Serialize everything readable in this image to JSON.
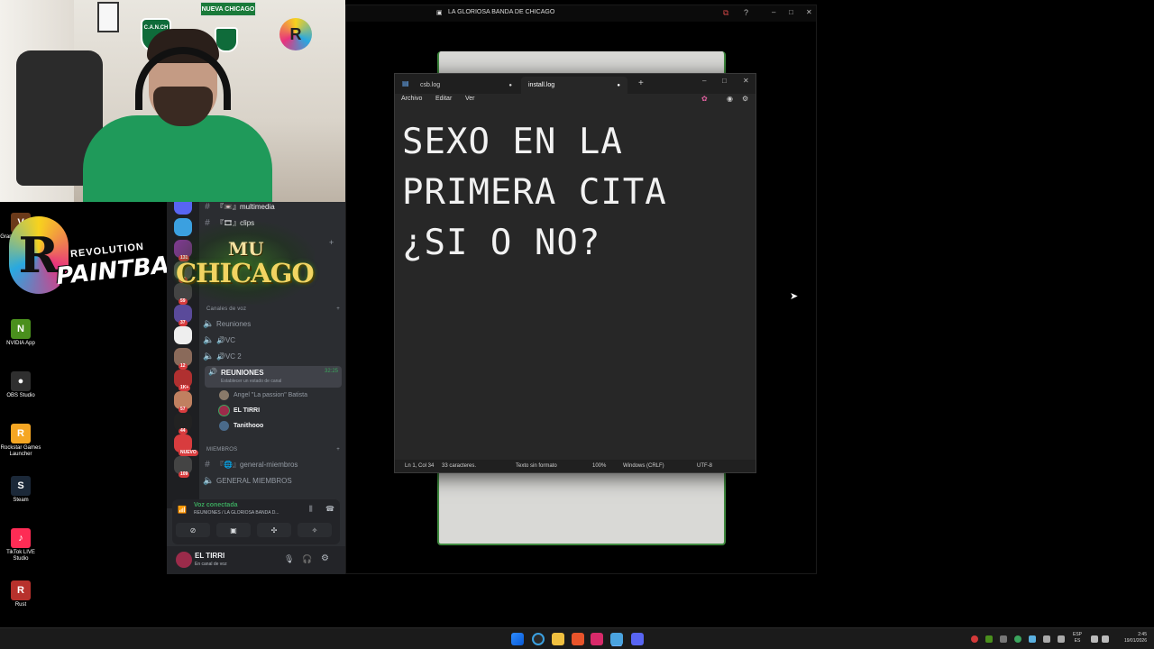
{
  "webcam": {
    "sign_text": "NUEVA CHICAGO",
    "shield_text": "C.A.N.CH",
    "logo_letter": "R"
  },
  "overlay": {
    "paintball_letter": "R",
    "paintball_line1": "REVOLUTION",
    "paintball_line2": "PAINTBALL",
    "mu_line1": "MU",
    "mu_line2": "CHICAGO"
  },
  "desktop_icons": [
    {
      "label": "Grand Theft Auto V Legacy",
      "color": "#6b3a1a",
      "glyph": "V"
    },
    {
      "label": "NVIDIA App",
      "color": "#4a8f1d",
      "glyph": "N"
    },
    {
      "label": "OBS Studio",
      "color": "#2f2f2f",
      "glyph": "●"
    },
    {
      "label": "Rockstar Games Launcher",
      "color": "#f5a623",
      "glyph": "R"
    },
    {
      "label": "Steam",
      "color": "#1b2838",
      "glyph": "S"
    },
    {
      "label": "TikTok LIVE Studio",
      "color": "#fe2c55",
      "glyph": "♪"
    },
    {
      "label": "Rust",
      "color": "#b7312c",
      "glyph": "R"
    }
  ],
  "main_window": {
    "title": "LA GLORIOSA BANDA DE CHICAGO"
  },
  "discord": {
    "server_badges": [
      "",
      "",
      "131",
      "37",
      "59",
      "37",
      "",
      "12",
      "1K+",
      "57",
      "44",
      "NUEVO",
      "109"
    ],
    "top_channels": [
      {
        "name": "『📼』multimedia"
      },
      {
        "name": "『🎞』clips"
      }
    ],
    "voice_category": "Canales de voz",
    "voice_channels": [
      {
        "name": "Reuniones"
      },
      {
        "name": "🔊VC"
      },
      {
        "name": "🔊VC 2"
      }
    ],
    "active_channel": {
      "name": "REUNIONES",
      "timer": "32:25",
      "status": "Establecer un estado de canal"
    },
    "voice_users": [
      {
        "name": "Angel \"La passion\" Batista",
        "bold": false
      },
      {
        "name": "EL TIRRI",
        "bold": true
      },
      {
        "name": "Tanithooo",
        "bold": true
      }
    ],
    "members_category": "MIEMBROS",
    "member_channels": [
      {
        "name": "『🌐』general-miembros"
      },
      {
        "name": "GENERAL MIEMBROS"
      }
    ],
    "voice_status": {
      "title": "Voz conectada",
      "subtitle": "REUNIONES / LA GLORIOSA BANDA D..."
    },
    "user": {
      "name": "EL TIRRI",
      "status": "En canal de voz"
    }
  },
  "notepad": {
    "tabs": [
      {
        "label": "csb.log",
        "active": false
      },
      {
        "label": "install.log",
        "active": true
      }
    ],
    "menu": [
      "Archivo",
      "Editar",
      "Ver"
    ],
    "content": "SEXO EN LA\nPRIMERA CITA\n¿SI O NO?",
    "status": {
      "position": "Ln 1, Col 34",
      "chars": "33 caracteres.",
      "format": "Texto sin formato",
      "zoom": "100%",
      "line_ending": "Windows (CRLF)",
      "encoding": "UTF-8"
    }
  },
  "taskbar": {
    "lang": "ESP",
    "lang_sub": "ES",
    "time": "2:45",
    "date": "19/01/2026"
  }
}
